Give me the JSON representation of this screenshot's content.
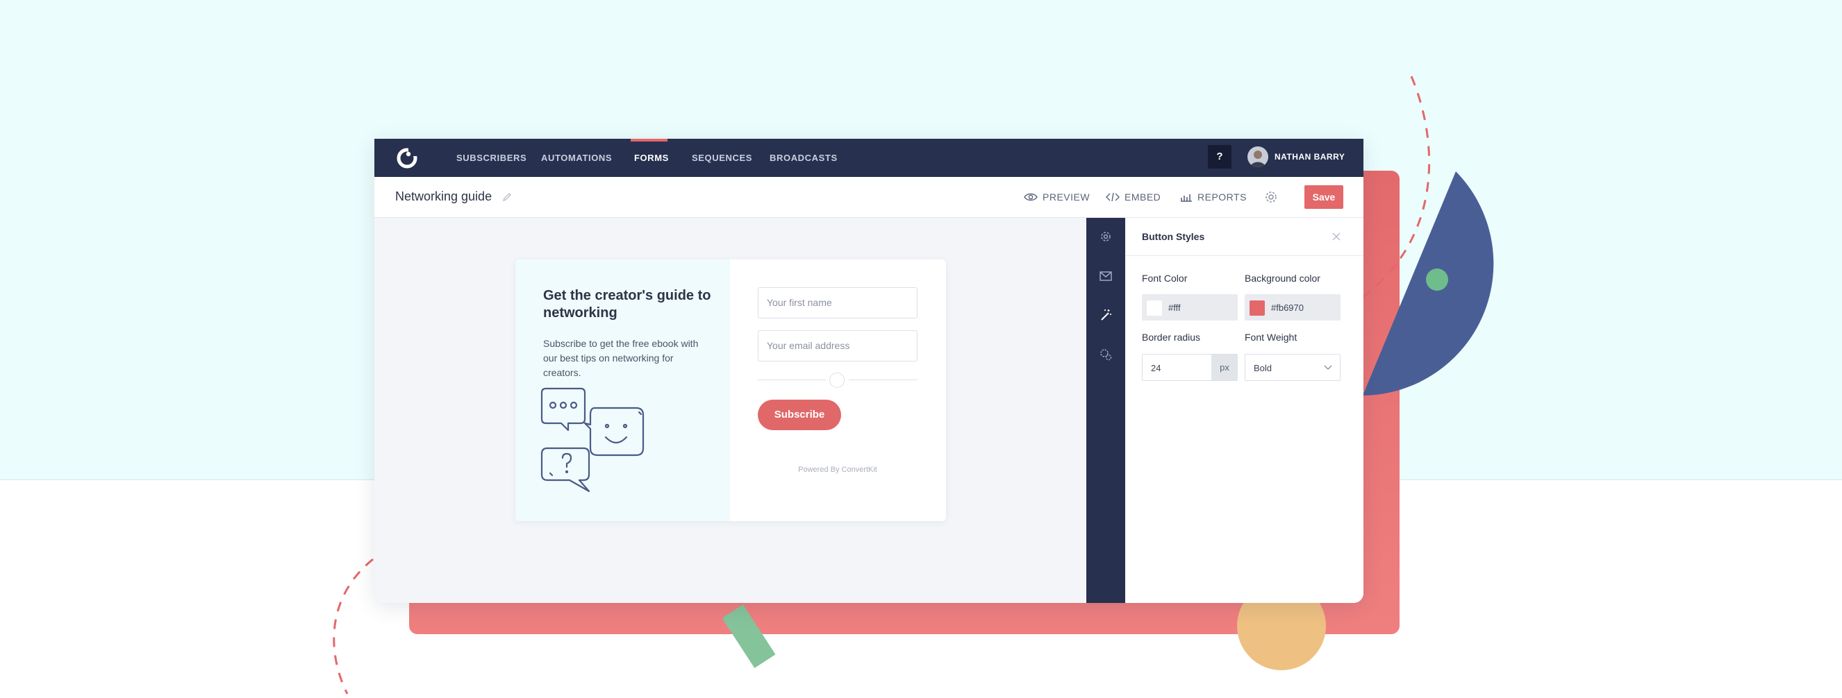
{
  "nav": {
    "items": [
      {
        "label": "SUBSCRIBERS"
      },
      {
        "label": "AUTOMATIONS"
      },
      {
        "label": "FORMS"
      },
      {
        "label": "SEQUENCES"
      },
      {
        "label": "BROADCASTS"
      }
    ],
    "active_item": "FORMS",
    "help_label": "?",
    "user_name": "NATHAN BARRY"
  },
  "header": {
    "form_title": "Networking guide",
    "preview_label": "PREVIEW",
    "embed_label": "EMBED",
    "reports_label": "REPORTS",
    "save_label": "Save"
  },
  "form_preview": {
    "title": "Get the creator's guide to networking",
    "description": "Subscribe to get the free ebook with our best tips on networking for creators.",
    "first_name_placeholder": "Your first name",
    "email_placeholder": "Your email address",
    "subscribe_label": "Subscribe",
    "powered_by": "Powered By ConvertKit"
  },
  "side_panel": {
    "title": "Button Styles",
    "font_color_label": "Font Color",
    "font_color_value": "#fff",
    "background_color_label": "Background color",
    "background_color_value": "#fb6970",
    "border_radius_label": "Border radius",
    "border_radius_value": "24",
    "border_radius_unit": "px",
    "font_weight_label": "Font Weight",
    "font_weight_value": "Bold"
  },
  "colors": {
    "nav_bg": "#27304e",
    "accent": "#e4676a",
    "page_bg_top": "#ebfdfd",
    "deco_blue": "#4a5e96",
    "deco_orange": "#eec082",
    "deco_green": "#85c39a"
  },
  "icons": [
    "logo-icon",
    "pencil-icon",
    "eye-icon",
    "code-icon",
    "bar-chart-icon",
    "gear-icon",
    "mail-icon",
    "magic-wand-icon",
    "gears-icon",
    "close-icon",
    "chevron-down-icon",
    "chat-bubbles-illustration"
  ]
}
